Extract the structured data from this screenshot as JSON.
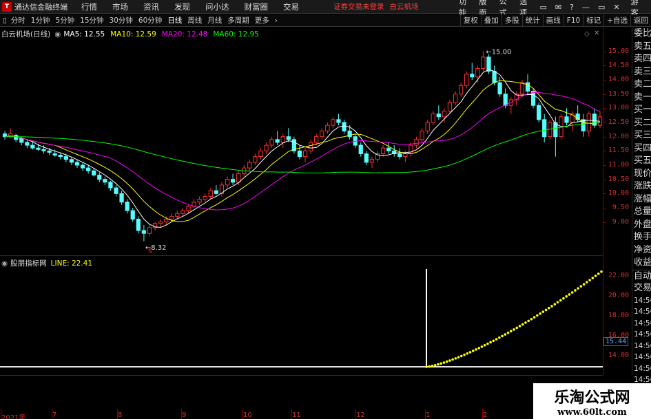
{
  "app": {
    "title": "通达信金融终端",
    "menu": [
      "行情",
      "市场",
      "资讯",
      "发现",
      "问小达",
      "财富圈",
      "交易"
    ],
    "status_message": "证券交易未登录",
    "current_stock": "白云机场",
    "right_menu": [
      "功能",
      "版面",
      "公式",
      "选项"
    ],
    "guest": "游客"
  },
  "toolbar": {
    "periods": [
      "分时",
      "1分钟",
      "5分钟",
      "15分钟",
      "30分钟",
      "60分钟",
      "日线",
      "周线",
      "月线",
      "多周期",
      "更多"
    ],
    "active_period": "日线",
    "right_buttons": [
      "复权",
      "叠加",
      "多股",
      "统计",
      "画线",
      "F10",
      "标记",
      "+自选",
      "返回"
    ]
  },
  "chart": {
    "stock_name": "白云机场(日线)",
    "ma": [
      {
        "label": "MA5: 12.55",
        "color": "#ffffff"
      },
      {
        "label": "MA10: 12.59",
        "color": "#ffff00"
      },
      {
        "label": "MA20: 12.48",
        "color": "#ff00ff"
      },
      {
        "label": "MA60: 12.95",
        "color": "#00ff00"
      }
    ],
    "price_ticks": [
      15.0,
      14.5,
      14.0,
      13.5,
      13.0,
      12.5,
      12.0,
      11.5,
      11.0,
      10.5,
      10.0,
      9.5,
      9.0
    ],
    "price_range": [
      8.0,
      15.5
    ],
    "high_marker": "15.00",
    "low_marker": "8.32",
    "up_color": "#ff3232",
    "down_color": "#54fcfc"
  },
  "indicator": {
    "name": "股朋指标网",
    "value_label": "LINE: 22.41",
    "ticks": [
      22.0,
      20.0,
      18.0,
      16.0,
      14.0
    ],
    "range": [
      12.5,
      23.5
    ],
    "current_value_box": "15.44",
    "line_color": "#ffff00"
  },
  "quote_panel": {
    "items": [
      "委比",
      "卖五",
      "卖四",
      "卖三",
      "卖二",
      "卖一",
      "买一",
      "买二",
      "买三",
      "买四",
      "买五",
      "现价",
      "涨跌",
      "涨幅",
      "总量",
      "外盘",
      "换手",
      "净资",
      "收益",
      "自动",
      "交易"
    ],
    "times": [
      "14:56",
      "14:56",
      "14:56",
      "14:56",
      "14:56",
      "14:56",
      "14:56",
      "14:56"
    ]
  },
  "date_axis": [
    {
      "label": "2021年"
    },
    {
      "label": "7"
    },
    {
      "label": "8"
    },
    {
      "label": "9"
    },
    {
      "label": "10"
    },
    {
      "label": "11"
    },
    {
      "label": "12"
    },
    {
      "label": "1"
    },
    {
      "label": "2"
    }
  ],
  "watermark": {
    "title": "乐淘公式网",
    "url": "www.60lt.com"
  },
  "chart_data": {
    "type": "candlestick",
    "candles": [
      [
        12.1,
        12.2,
        11.9,
        12.0
      ],
      [
        12.0,
        12.3,
        11.95,
        12.1
      ],
      [
        12.05,
        12.1,
        11.8,
        11.9
      ],
      [
        11.95,
        12.0,
        11.7,
        11.8
      ],
      [
        11.8,
        11.9,
        11.6,
        11.7
      ],
      [
        11.7,
        11.85,
        11.55,
        11.6
      ],
      [
        11.6,
        11.75,
        11.5,
        11.55
      ],
      [
        11.55,
        11.7,
        11.4,
        11.5
      ],
      [
        11.5,
        11.6,
        11.35,
        11.45
      ],
      [
        11.4,
        11.55,
        11.3,
        11.35
      ],
      [
        11.35,
        11.45,
        11.2,
        11.3
      ],
      [
        11.3,
        11.4,
        11.1,
        11.2
      ],
      [
        11.2,
        11.3,
        11.0,
        11.1
      ],
      [
        11.1,
        11.2,
        10.9,
        11.0
      ],
      [
        11.0,
        11.1,
        10.8,
        10.9
      ],
      [
        10.9,
        11.0,
        10.7,
        10.8
      ],
      [
        10.8,
        10.9,
        10.6,
        10.65
      ],
      [
        10.65,
        10.75,
        10.4,
        10.5
      ],
      [
        10.5,
        10.6,
        10.3,
        10.4
      ],
      [
        10.4,
        10.45,
        10.1,
        10.2
      ],
      [
        10.2,
        10.3,
        9.9,
        10.0
      ],
      [
        10.0,
        10.1,
        9.6,
        9.7
      ],
      [
        9.7,
        9.8,
        9.3,
        9.4
      ],
      [
        9.4,
        9.5,
        9.0,
        9.1
      ],
      [
        9.1,
        9.2,
        8.6,
        8.7
      ],
      [
        8.7,
        8.9,
        8.32,
        8.6
      ],
      [
        8.6,
        8.9,
        8.5,
        8.8
      ],
      [
        8.8,
        9.0,
        8.7,
        8.95
      ],
      [
        8.95,
        9.1,
        8.8,
        9.0
      ],
      [
        9.0,
        9.2,
        8.9,
        9.1
      ],
      [
        9.1,
        9.3,
        9.0,
        9.2
      ],
      [
        9.2,
        9.4,
        9.1,
        9.3
      ],
      [
        9.3,
        9.5,
        9.2,
        9.4
      ],
      [
        9.4,
        9.6,
        9.3,
        9.55
      ],
      [
        9.55,
        9.8,
        9.5,
        9.7
      ],
      [
        9.7,
        9.9,
        9.6,
        9.8
      ],
      [
        9.8,
        10.0,
        9.7,
        9.9
      ],
      [
        9.9,
        10.2,
        9.8,
        10.1
      ],
      [
        10.1,
        10.3,
        9.95,
        10.0
      ],
      [
        10.0,
        10.4,
        9.9,
        10.3
      ],
      [
        10.3,
        10.6,
        10.2,
        10.5
      ],
      [
        10.5,
        10.7,
        10.3,
        10.4
      ],
      [
        10.4,
        10.8,
        10.3,
        10.7
      ],
      [
        10.7,
        11.0,
        10.6,
        10.9
      ],
      [
        10.9,
        11.2,
        10.8,
        11.1
      ],
      [
        11.1,
        11.4,
        11.0,
        11.3
      ],
      [
        11.3,
        11.6,
        11.2,
        11.5
      ],
      [
        11.5,
        11.8,
        11.4,
        11.7
      ],
      [
        11.7,
        12.0,
        11.6,
        11.9
      ],
      [
        11.9,
        12.2,
        11.7,
        11.8
      ],
      [
        11.8,
        12.1,
        11.6,
        12.0
      ],
      [
        12.0,
        12.3,
        11.8,
        11.9
      ],
      [
        11.9,
        12.0,
        11.4,
        11.5
      ],
      [
        11.5,
        11.7,
        11.2,
        11.3
      ],
      [
        11.3,
        11.6,
        11.1,
        11.5
      ],
      [
        11.5,
        11.9,
        11.4,
        11.8
      ],
      [
        11.8,
        12.1,
        11.7,
        12.0
      ],
      [
        12.0,
        12.3,
        11.9,
        12.2
      ],
      [
        12.2,
        12.5,
        12.1,
        12.4
      ],
      [
        12.4,
        12.7,
        12.3,
        12.6
      ],
      [
        12.6,
        12.8,
        12.4,
        12.5
      ],
      [
        12.5,
        12.6,
        12.1,
        12.2
      ],
      [
        12.2,
        12.4,
        11.9,
        12.0
      ],
      [
        12.0,
        12.1,
        11.6,
        11.7
      ],
      [
        11.7,
        11.8,
        11.3,
        11.4
      ],
      [
        11.4,
        11.5,
        11.0,
        11.1
      ],
      [
        11.1,
        11.3,
        10.9,
        11.2
      ],
      [
        11.2,
        11.5,
        11.1,
        11.4
      ],
      [
        11.4,
        11.7,
        11.3,
        11.6
      ],
      [
        11.6,
        11.8,
        11.4,
        11.5
      ],
      [
        11.5,
        11.7,
        11.3,
        11.4
      ],
      [
        11.4,
        11.6,
        11.2,
        11.3
      ],
      [
        11.3,
        11.5,
        11.1,
        11.4
      ],
      [
        11.4,
        11.8,
        11.3,
        11.7
      ],
      [
        11.7,
        12.0,
        11.6,
        11.9
      ],
      [
        11.9,
        12.3,
        11.8,
        12.2
      ],
      [
        12.2,
        12.6,
        12.1,
        12.5
      ],
      [
        12.5,
        12.9,
        12.4,
        12.8
      ],
      [
        12.8,
        13.1,
        12.6,
        12.7
      ],
      [
        12.7,
        13.0,
        12.5,
        12.9
      ],
      [
        12.9,
        13.3,
        12.8,
        13.2
      ],
      [
        13.2,
        13.6,
        13.1,
        13.5
      ],
      [
        13.5,
        13.9,
        13.4,
        13.8
      ],
      [
        13.8,
        14.3,
        13.7,
        14.2
      ],
      [
        14.2,
        14.6,
        14.0,
        14.1
      ],
      [
        14.1,
        14.5,
        13.9,
        14.4
      ],
      [
        14.4,
        15.0,
        14.3,
        14.8
      ],
      [
        14.8,
        14.9,
        14.2,
        14.3
      ],
      [
        14.3,
        14.5,
        13.8,
        13.9
      ],
      [
        13.9,
        14.1,
        13.4,
        13.5
      ],
      [
        13.5,
        13.7,
        13.0,
        13.1
      ],
      [
        13.1,
        13.4,
        12.8,
        13.3
      ],
      [
        13.3,
        13.6,
        13.1,
        13.5
      ],
      [
        13.5,
        14.0,
        13.4,
        13.9
      ],
      [
        13.9,
        14.2,
        13.5,
        13.6
      ],
      [
        13.6,
        13.7,
        13.0,
        13.1
      ],
      [
        13.1,
        13.2,
        12.5,
        12.6
      ],
      [
        12.6,
        12.8,
        11.8,
        12.0
      ],
      [
        12.0,
        12.6,
        11.9,
        12.5
      ],
      [
        12.5,
        12.7,
        11.3,
        12.0
      ],
      [
        12.0,
        12.8,
        11.9,
        12.7
      ],
      [
        12.7,
        13.0,
        12.4,
        12.5
      ],
      [
        12.5,
        12.9,
        12.2,
        12.8
      ],
      [
        12.8,
        13.1,
        12.5,
        12.6
      ],
      [
        12.6,
        12.8,
        12.0,
        12.2
      ],
      [
        12.2,
        12.9,
        12.0,
        12.8
      ],
      [
        12.8,
        13.0,
        12.3,
        12.4
      ],
      [
        12.4,
        12.9,
        12.3,
        12.7
      ]
    ],
    "indicator_line_start": 12.9,
    "indicator_line_end": 22.41
  }
}
